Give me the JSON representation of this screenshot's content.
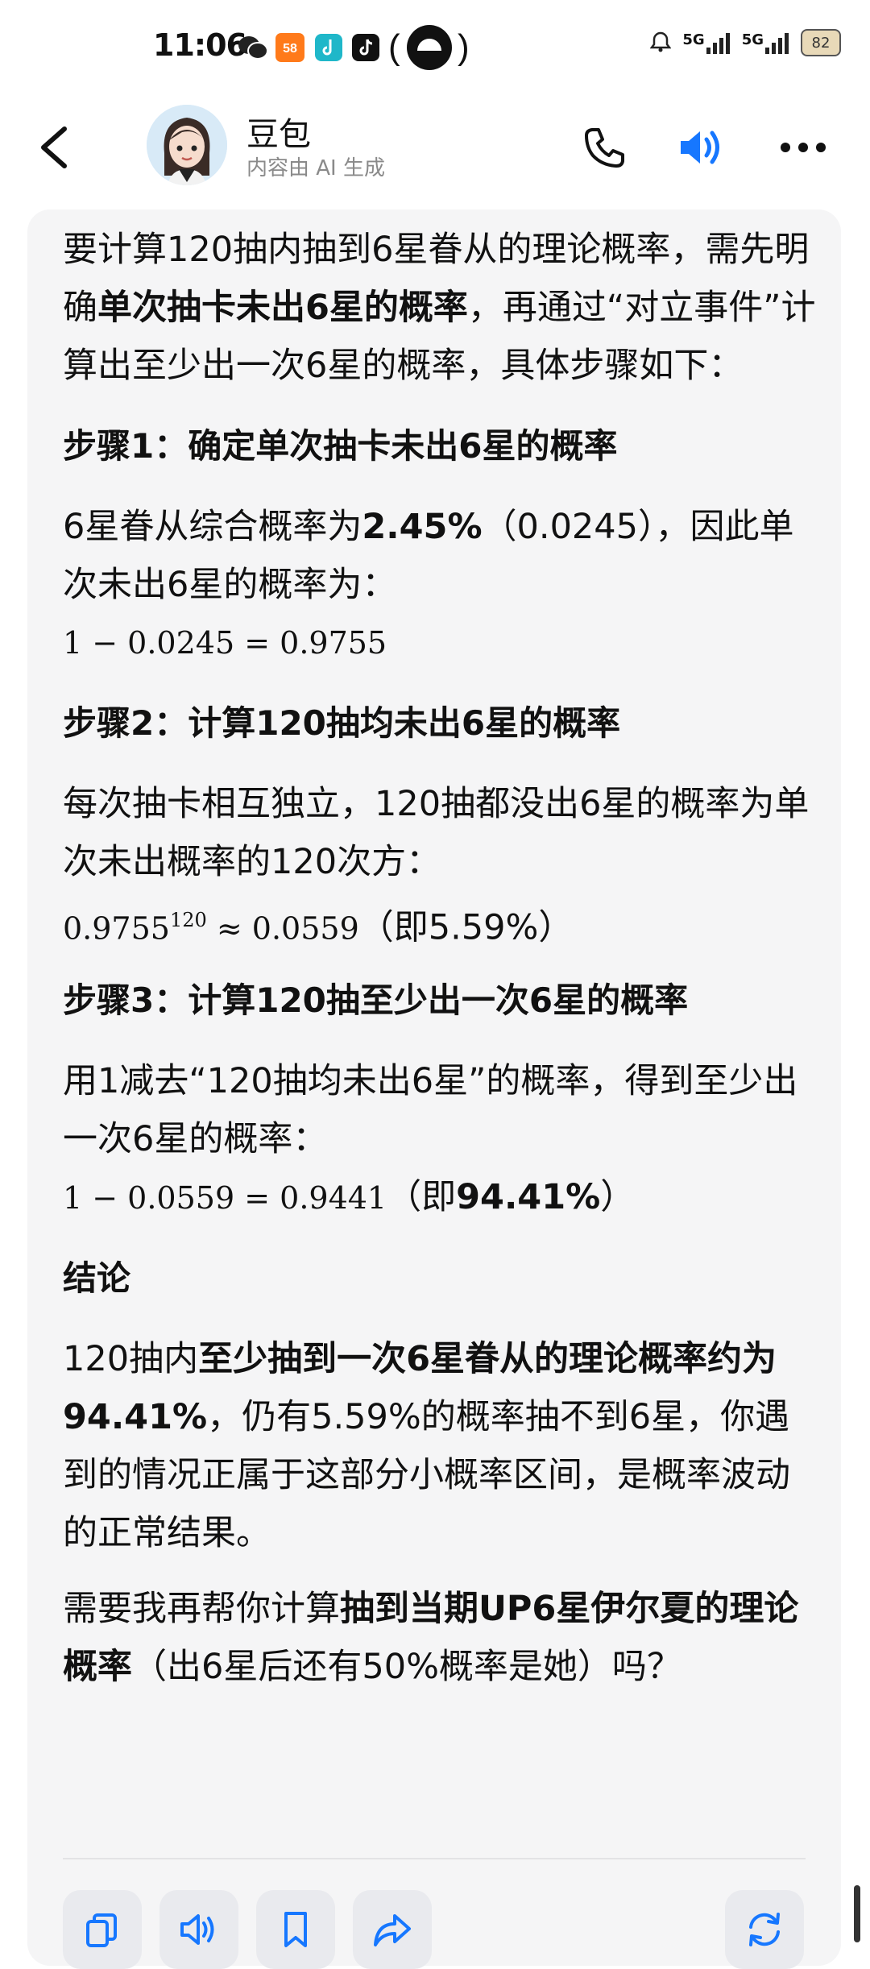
{
  "status_bar": {
    "time": "11:06",
    "icons": [
      "wechat-icon",
      "58-app-icon",
      "tiktok-lite-icon",
      "tiktok-icon",
      "hotspot-icon"
    ],
    "network_1": "5G",
    "network_2": "5G",
    "battery": "82"
  },
  "header": {
    "name": "豆包",
    "subtitle": "内容由 AI 生成",
    "accent": "#1677ff"
  },
  "message": {
    "intro_1": "要计算120抽内抽到6星眷从的理论概率，需先明确",
    "intro_bold": "单次抽卡未出6星的概率",
    "intro_2": "，再通过“对立事件”计算出至少出一次6星的概率，具体步骤如下：",
    "step1_title": "步骤1：确定单次抽卡未出6星的概率",
    "step1_text_1": "6星眷从综合概率为",
    "step1_bold": "2.45%",
    "step1_text_2": "（0.0245），因此单次未出6星的概率为：",
    "step1_math": "1 − 0.0245 = 0.9755",
    "step2_title": "步骤2：计算120抽均未出6星的概率",
    "step2_text": "每次抽卡相互独立，120抽都没出6星的概率为单次未出概率的120次方：",
    "step2_math_base": "0.9755",
    "step2_math_exp": "120",
    "step2_math_rest": " ≈ 0.0559",
    "step2_note": "（即5.59%）",
    "step3_title": "步骤3：计算120抽至少出一次6星的概率",
    "step3_text": "用1减去“120抽均未出6星”的概率，得到至少出一次6星的概率：",
    "step3_math": "1 − 0.0559 = 0.9441",
    "step3_note_1": "（即",
    "step3_note_bold": "94.41%",
    "step3_note_2": "）",
    "conclusion_title": "结论",
    "conclusion_1": "120抽内",
    "conclusion_bold": "至少抽到一次6星眷从的理论概率约为94.41%",
    "conclusion_2": "，仍有5.59%的概率抽不到6星，你遇到的情况正属于这部分小概率区间，是概率波动的正常结果。",
    "followup_1": "需要我再帮你计算",
    "followup_bold": "抽到当期UP6星伊尔夏的理论概率",
    "followup_2": "（出6星后还有50%概率是她）吗？"
  },
  "actions": [
    "copy-icon",
    "speaker-icon",
    "bookmark-icon",
    "share-icon",
    "regenerate-icon"
  ]
}
